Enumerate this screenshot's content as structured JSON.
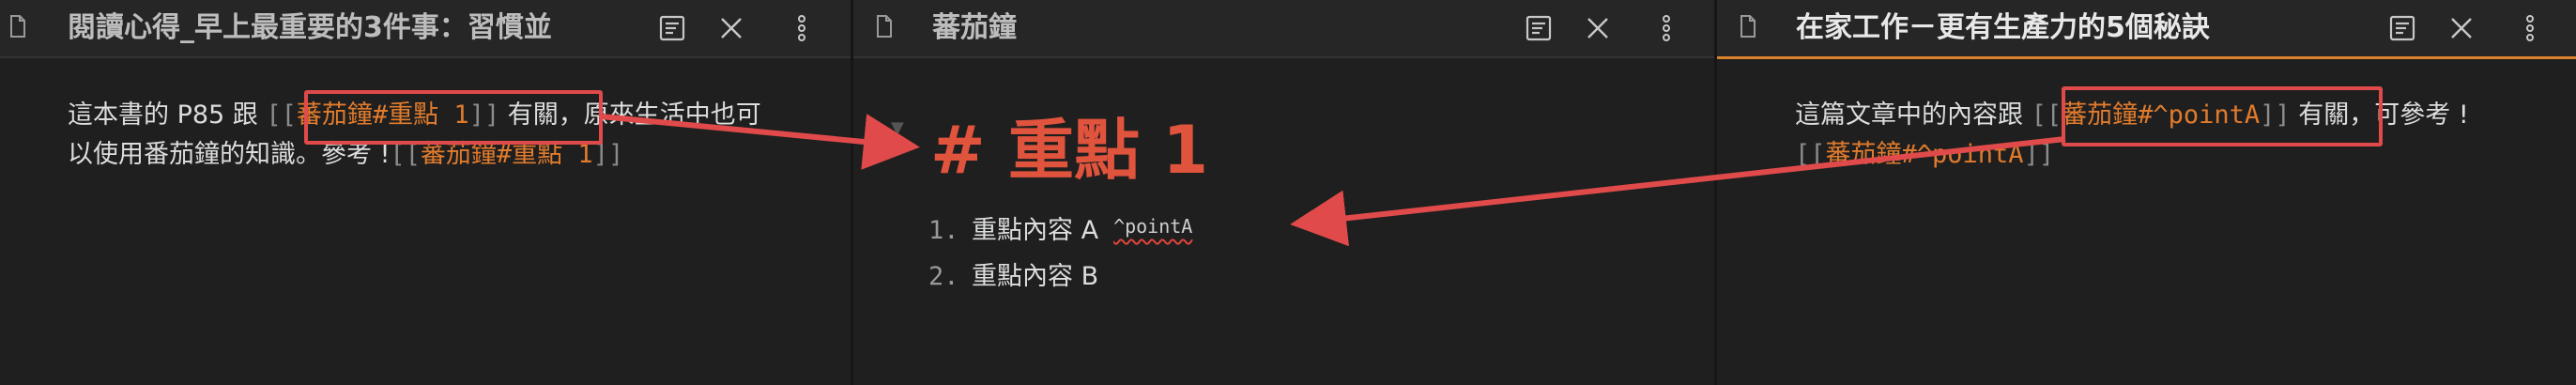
{
  "colors": {
    "accent": "#e07b2d",
    "heading": "#e0533d",
    "annotation": "#e04a4a"
  },
  "pane_left": {
    "title": "閱讀心得_早上最重要的3件事：習慣並",
    "body_prefix": "這本書的 P85 跟 ",
    "link1_open": "[[",
    "link1_text": "蕃茄鐘#重點 1",
    "link1_close": "]]",
    "body_middle": " 有關，原來生活中也可以使用番茄鐘的知識。參考 !",
    "link2_open": "[[",
    "link2_text": "蕃茄鐘#重點 1",
    "link2_close": "]]"
  },
  "pane_middle": {
    "title": "蕃茄鐘",
    "heading": "# 重點 1",
    "items": [
      {
        "num": "1.",
        "text": "重點內容 A",
        "block_ref": "^pointA"
      },
      {
        "num": "2.",
        "text": "重點內容 B",
        "block_ref": ""
      }
    ]
  },
  "pane_right": {
    "title": "在家工作－更有生產力的5個秘訣",
    "body_prefix": "這篇文章中的內容跟 ",
    "link1_open": "[[",
    "link1_text": "蕃茄鐘#^pointA",
    "link1_close": "]]",
    "body_middle": " 有關，可參考 !",
    "link2_open": "[[",
    "link2_text": "蕃茄鐘#^pointA",
    "link2_close": "]]"
  },
  "icons": [
    "document-icon",
    "reading-view-icon",
    "close-icon",
    "more-options-icon"
  ]
}
